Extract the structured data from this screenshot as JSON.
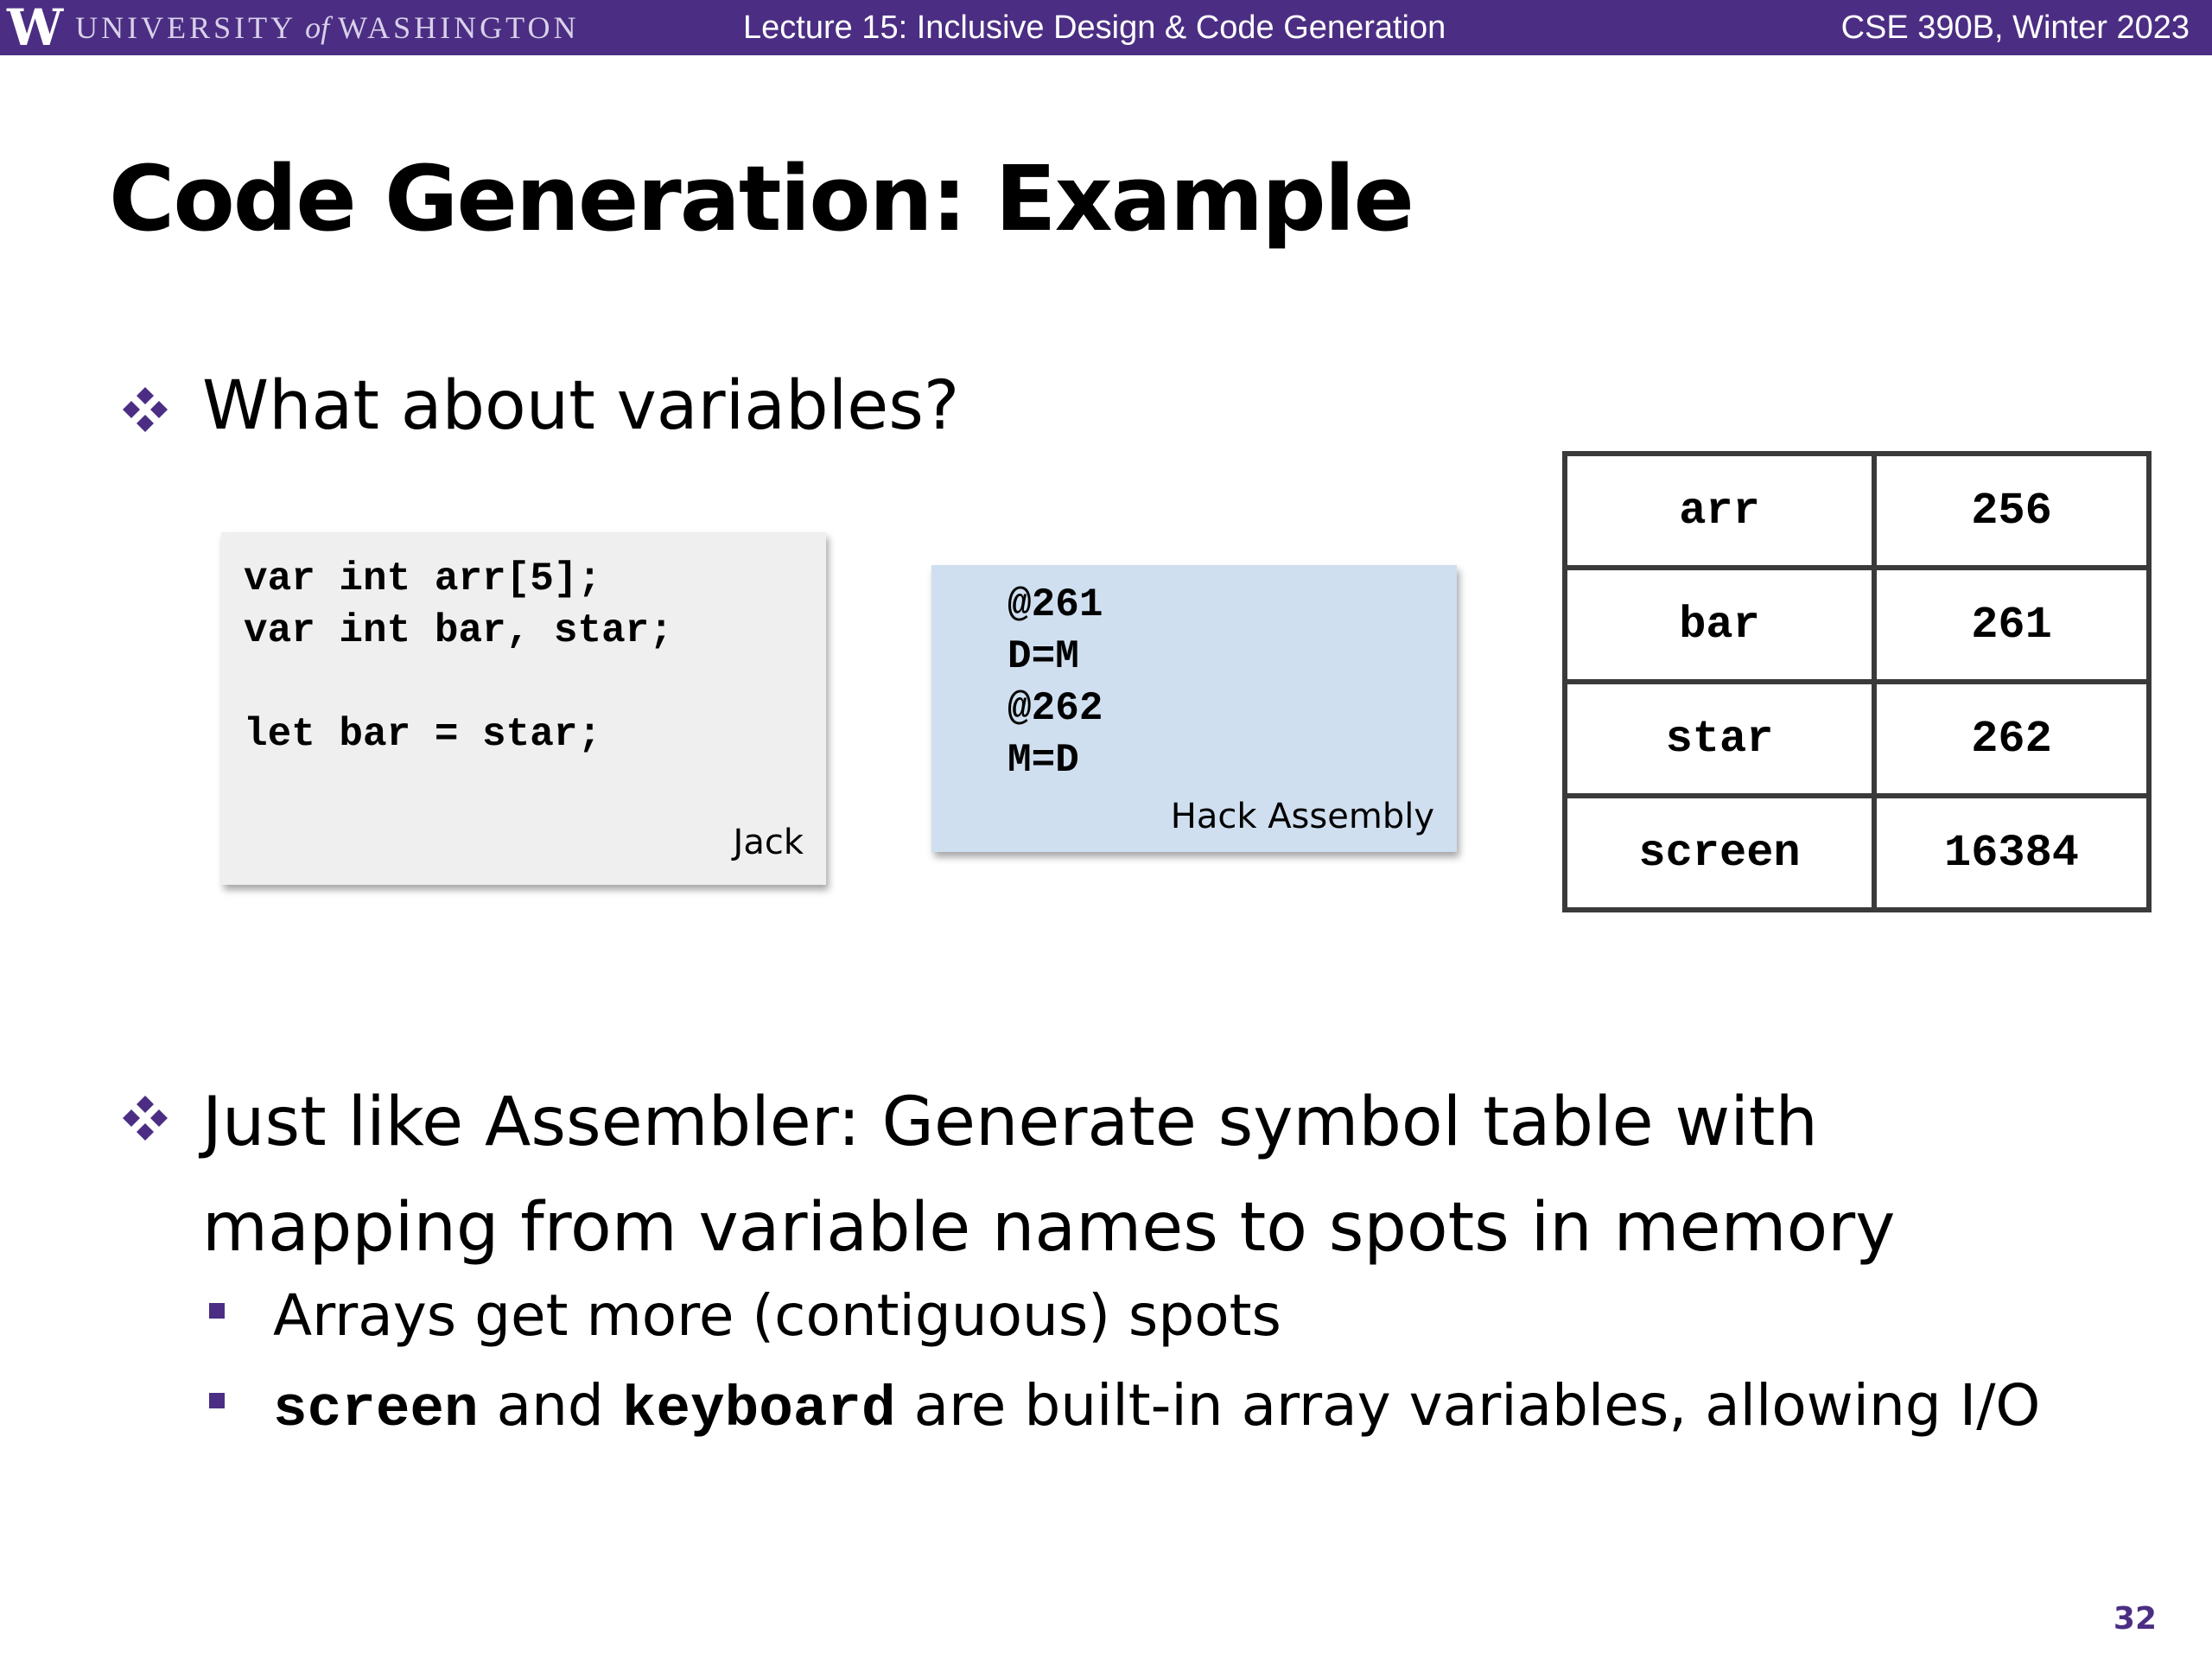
{
  "header": {
    "logo_letter": "W",
    "logo_text_left": "UNIVERSITY",
    "logo_text_of": "of",
    "logo_text_right": "WASHINGTON",
    "lecture": "Lecture 15: Inclusive Design & Code Generation",
    "course": "CSE 390B, Winter 2023"
  },
  "slide": {
    "title": "Code Generation: Example",
    "bullet1": "What about variables?",
    "jack": {
      "code": "var int arr[5];\nvar int bar, star;\n\nlet bar = star;",
      "label": "Jack"
    },
    "hack": {
      "code": "@261\nD=M\n@262\nM=D",
      "label": "Hack Assembly"
    },
    "symbol_table": [
      {
        "name": "arr",
        "address": "256"
      },
      {
        "name": "bar",
        "address": "261"
      },
      {
        "name": "star",
        "address": "262"
      },
      {
        "name": "screen",
        "address": "16384"
      }
    ],
    "bullet2": "Just like Assembler: Generate symbol table with mapping from variable names to spots in memory",
    "sub1": "Arrays get more (contiguous) spots",
    "sub2": {
      "code1": "screen",
      "text1": " and ",
      "code2": "keyboard",
      "text2": " are built-in array variables, allowing I/O"
    },
    "page_number": "32"
  },
  "colors": {
    "brand_purple": "#4b2e83",
    "jack_box_bg": "#efefef",
    "hack_box_bg": "#cfdff0"
  },
  "icons": {
    "bullet": "four-diamond-bullet-icon",
    "sub_bullet": "square-bullet-icon"
  }
}
